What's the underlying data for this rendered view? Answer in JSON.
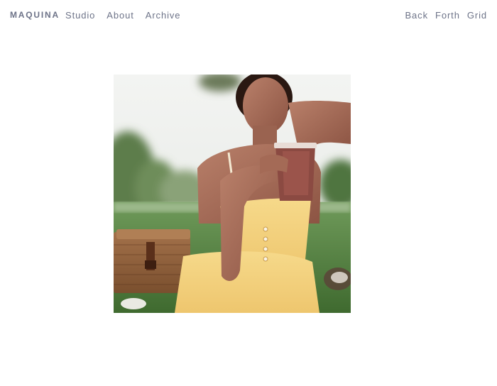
{
  "site": {
    "brand": "MAQUINA"
  },
  "nav": {
    "left": [
      {
        "label": "Studio"
      },
      {
        "label": "About"
      },
      {
        "label": "Archive"
      }
    ],
    "right": [
      {
        "label": "Back"
      },
      {
        "label": "Forth"
      },
      {
        "label": "Grid"
      }
    ]
  },
  "photo": {
    "subject": "woman in yellow sundress holding a cup at a picnic in a park",
    "icon": "photo-image"
  },
  "colors": {
    "nav_text": "#6d7388",
    "background": "#ffffff"
  }
}
